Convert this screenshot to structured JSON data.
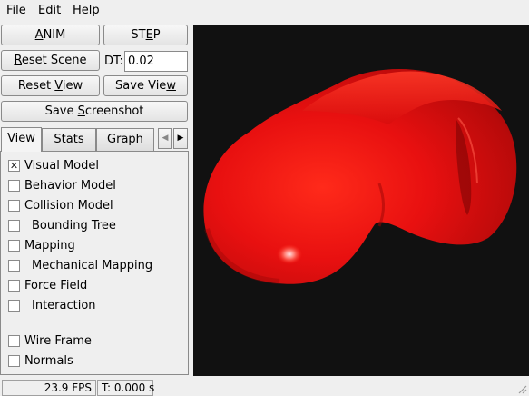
{
  "menu": [
    {
      "underline": "F",
      "rest": "ile"
    },
    {
      "underline": "E",
      "rest": "dit"
    },
    {
      "underline": "H",
      "rest": "elp"
    }
  ],
  "controls": {
    "anim": {
      "pre": "",
      "ul": "A",
      "post": "NIM"
    },
    "step": {
      "pre": "ST",
      "ul": "E",
      "post": "P"
    },
    "reset_scene": {
      "pre": "",
      "ul": "R",
      "post": "eset Scene"
    },
    "dt_label": "DT:",
    "dt_value": "0.02",
    "reset_view": {
      "pre": "Reset ",
      "ul": "V",
      "post": "iew"
    },
    "save_view": {
      "pre": "Save Vie",
      "ul": "w",
      "post": ""
    },
    "save_screenshot": {
      "pre": "Save ",
      "ul": "S",
      "post": "creenshot"
    }
  },
  "tabs": [
    "View",
    "Stats",
    "Graph"
  ],
  "tab_arrows": {
    "left": "◀",
    "right": "▶"
  },
  "view_options": [
    {
      "label": "Visual Model",
      "checked": true
    },
    {
      "label": "Behavior Model",
      "checked": false
    },
    {
      "label": "Collision Model",
      "checked": false
    },
    {
      "label": "Bounding Tree",
      "checked": false
    },
    {
      "label": "Mapping",
      "checked": false
    },
    {
      "label": "Mechanical Mapping",
      "checked": false
    },
    {
      "label": "Force Field",
      "checked": false
    },
    {
      "label": "Interaction",
      "checked": false
    },
    {
      "label": "Wire Frame",
      "checked": false
    },
    {
      "label": "Normals",
      "checked": false
    }
  ],
  "check_mark": "✕",
  "status": {
    "fps": "23.9 FPS",
    "time": "T: 0.000 s"
  },
  "colors": {
    "viewport_bg": "#111111",
    "model": "#e81010"
  }
}
